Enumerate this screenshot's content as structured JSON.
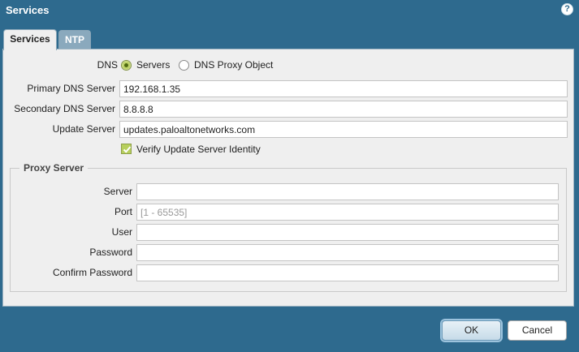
{
  "dialog": {
    "title": "Services",
    "help_icon": "help-icon",
    "help_glyph": "?"
  },
  "tabs": [
    {
      "label": "Services",
      "active": true
    },
    {
      "label": "NTP",
      "active": false
    }
  ],
  "dns": {
    "label": "DNS",
    "options": [
      {
        "label": "Servers",
        "selected": true
      },
      {
        "label": "DNS Proxy Object",
        "selected": false
      }
    ]
  },
  "primary_dns": {
    "label": "Primary DNS Server",
    "value": "192.168.1.35"
  },
  "secondary_dns": {
    "label": "Secondary DNS Server",
    "value": "8.8.8.8"
  },
  "update_server": {
    "label": "Update Server",
    "value": "updates.paloaltonetworks.com"
  },
  "verify_identity": {
    "label": "Verify Update Server Identity",
    "checked": true
  },
  "proxy": {
    "legend": "Proxy Server",
    "server": {
      "label": "Server",
      "value": ""
    },
    "port": {
      "label": "Port",
      "value": "",
      "placeholder": "[1 - 65535]"
    },
    "user": {
      "label": "User",
      "value": ""
    },
    "password": {
      "label": "Password",
      "value": ""
    },
    "confirm_password": {
      "label": "Confirm Password",
      "value": ""
    }
  },
  "buttons": {
    "ok": "OK",
    "cancel": "Cancel"
  },
  "colors": {
    "dialog_bg": "#2e6a8e",
    "panel_bg": "#efefef",
    "accent_green": "#b7cf5d"
  }
}
